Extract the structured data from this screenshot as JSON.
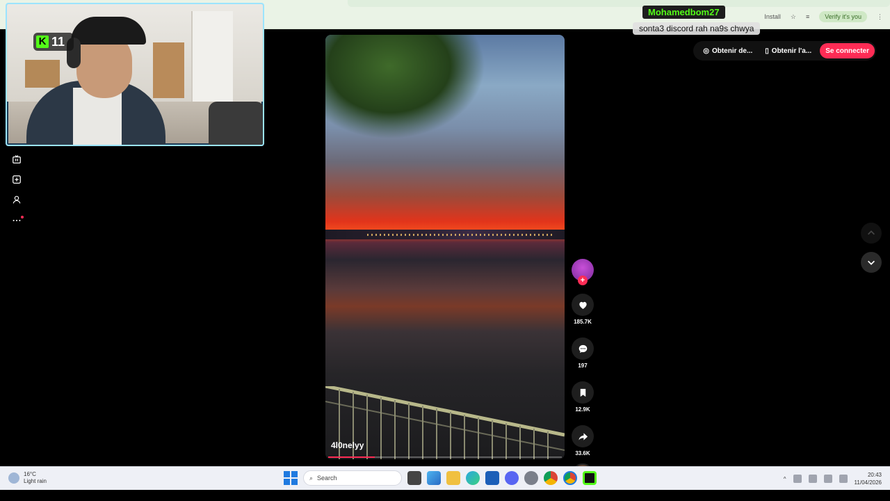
{
  "browser": {
    "install_label": "Install",
    "verify_label": "Verify it's you"
  },
  "stream": {
    "platform_badge_icon": "kick-logo-icon",
    "viewer_count": "11"
  },
  "chat": {
    "username": "Mohamedbom27",
    "message": "sonta3 discord rah na9s chwya"
  },
  "header": {
    "get_desktop_label": "Obtenir de...",
    "get_app_label": "Obtenir l'a...",
    "login_label": "Se connecter",
    "login_color": "#fe2c55"
  },
  "sidebar": {
    "items": [
      {
        "name": "live",
        "icon": "tv-icon"
      },
      {
        "name": "upload",
        "icon": "plus-square-icon"
      },
      {
        "name": "profile",
        "icon": "user-icon"
      },
      {
        "name": "more",
        "icon": "more-icon"
      }
    ]
  },
  "video": {
    "author": "4l0nelyy",
    "progress": 0.2
  },
  "actions": {
    "likes": "185.7K",
    "comments": "197",
    "saves": "12.9K",
    "shares": "33.6K"
  },
  "taskbar": {
    "temperature": "16°C",
    "weather": "Light rain",
    "search_placeholder": "Search",
    "time": "20:43",
    "date": "11/04/2026"
  }
}
